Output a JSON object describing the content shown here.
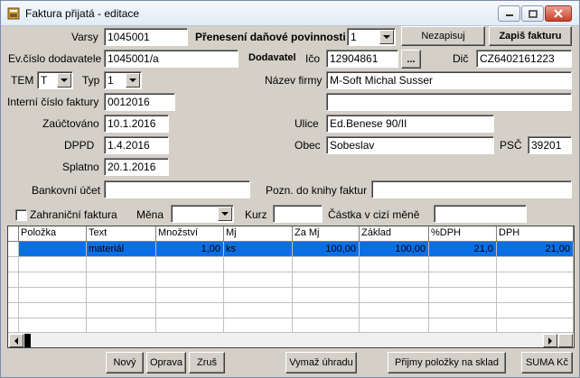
{
  "window": {
    "title": "Faktura přijatá - editace",
    "controls": [
      "minimize-icon",
      "maximize-icon",
      "close-icon"
    ]
  },
  "top_buttons": {
    "nezapisuj": "Nezapisuj",
    "zapis_fakturu": "Zapiš fakturu"
  },
  "form": {
    "varsy_label": "Varsy",
    "varsy_value": "1045001",
    "prenos_label": "Přenesení daňové povinnosti",
    "prenos_value": "1",
    "evcislo_label": "Ev.číslo dodavatele",
    "evcislo_value": "1045001/a",
    "dodavatel_label": "Dodavatel",
    "ico_label": "Ičo",
    "ico_value": "12904861",
    "ico_button": "...",
    "dic_label": "Dič",
    "dic_value": "CZ6402161223",
    "tem_label": "TEM",
    "tem_value": "T",
    "typ_label": "Typ",
    "typ_value": "1",
    "nazev_label": "Název firmy",
    "nazev_value": "M-Soft Michal Susser",
    "nazev2_value": "",
    "interni_label": "Interní číslo faktury",
    "interni_value": "0012016",
    "zauctovano_label": "Zaúčtováno",
    "zauctovano_value": "10.1.2016",
    "ulice_label": "Ulice",
    "ulice_value": "Ed.Benese 90/II",
    "dppd_label": "DPPD",
    "dppd_value": "1.4.2016",
    "obec_label": "Obec",
    "obec_value": "Sobeslav",
    "psc_label": "PSČ",
    "psc_value": "39201",
    "splatno_label": "Splatno",
    "splatno_value": "20.1.2016",
    "bankovni_label": "Bankovní účet",
    "bankovni_value": "",
    "pozn_label": "Pozn. do knihy faktur",
    "pozn_value": "",
    "zahranicni_label": "Zahraniční faktura",
    "zahranicni_checked": false,
    "mena_label": "Měna",
    "mena_value": "",
    "kurz_label": "Kurz",
    "kurz_value": "",
    "castka_label": "Částka v cizí měně",
    "castka_value": ""
  },
  "grid": {
    "columns": [
      "Položka",
      "Text",
      "Množství",
      "Mj",
      "Za Mj",
      "Základ",
      "%DPH",
      "DPH"
    ],
    "rows": [
      [
        "",
        "materiál",
        "1,00",
        "ks",
        "100,00",
        "100,00",
        "21,0",
        "21,00"
      ]
    ],
    "selected_row": 0
  },
  "bottom_buttons": {
    "novy": "Nový",
    "oprava": "Oprava",
    "zrus": "Zruš",
    "vymaz": "Vymaž úhradu",
    "prijmy": "Přijmy položky na sklad",
    "suma": "SUMA Kč"
  },
  "colors": {
    "selection": "#0a6fe6",
    "face": "#d4d0c8"
  }
}
